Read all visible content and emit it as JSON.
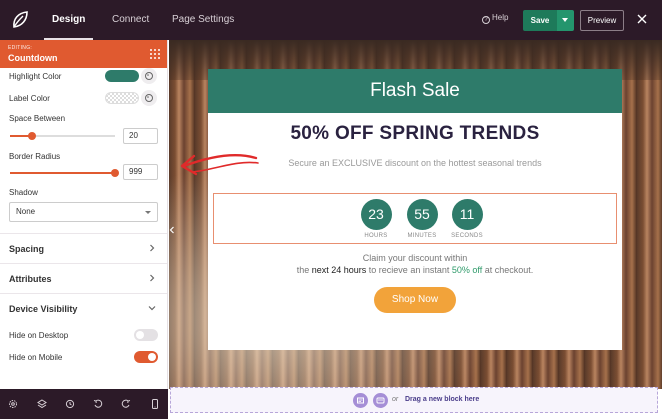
{
  "topbar": {
    "tabs": [
      {
        "label": "Design",
        "active": true
      },
      {
        "label": "Connect",
        "active": false
      },
      {
        "label": "Page Settings",
        "active": false
      }
    ],
    "help_label": "Help",
    "save_label": "Save",
    "preview_label": "Preview"
  },
  "sidebar": {
    "editing_label": "EDITING:",
    "block_name": "Countdown",
    "highlight_color": {
      "label": "Highlight Color",
      "value": "#2e7b6a"
    },
    "label_color": {
      "label": "Label Color",
      "value": "transparent"
    },
    "space_between": {
      "label": "Space Between",
      "value": "20",
      "fraction": 0.2
    },
    "border_radius": {
      "label": "Border Radius",
      "value": "999",
      "fraction": 1.0
    },
    "shadow": {
      "label": "Shadow",
      "value": "None"
    },
    "sections": [
      "Spacing",
      "Attributes",
      "Device Visibility"
    ],
    "hide_desktop": {
      "label": "Hide on Desktop",
      "on": false
    },
    "hide_mobile": {
      "label": "Hide on Mobile",
      "on": true
    }
  },
  "popup": {
    "header": "Flash Sale",
    "title": "50% OFF SPRING TRENDS",
    "subtitle": "Secure an EXCLUSIVE discount on the hottest seasonal trends",
    "countdown": [
      {
        "value": "23",
        "label": "HOURS"
      },
      {
        "value": "55",
        "label": "MINUTES"
      },
      {
        "value": "11",
        "label": "SECONDS"
      }
    ],
    "line1": "Claim your discount within",
    "line2_a": "the ",
    "line2_b": "next 24 hours",
    "line2_c": " to recieve an instant ",
    "line2_d": "50% off",
    "line2_e": " at checkout.",
    "button": "Shop Now"
  },
  "dropzone": {
    "or": "or",
    "text": "Drag a new block here"
  },
  "colors": {
    "brand_dark": "#2c1a28",
    "accent": "#e05a30",
    "teal": "#2e7b6a",
    "save_green": "#1e7a5a",
    "button_orange": "#f2a33a"
  }
}
